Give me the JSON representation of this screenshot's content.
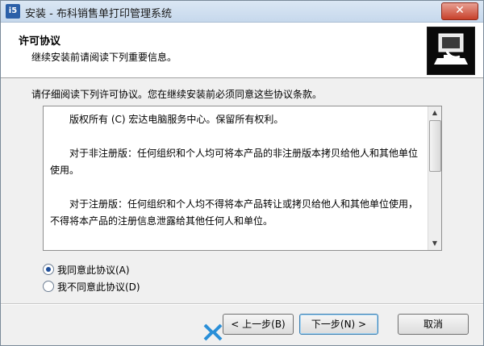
{
  "window": {
    "title": "安装 - 布科销售单打印管理系统",
    "icon_label": "i5",
    "close_label": "✕"
  },
  "header": {
    "title": "许可协议",
    "subtitle": "继续安装前请阅读下列重要信息。"
  },
  "prompt": "请仔细阅读下列许可协议。您在继续安装前必须同意这些协议条款。",
  "license": {
    "paragraphs": [
      "版权所有 (C) 宏达电脑服务中心。保留所有权利。",
      "对于非注册版：任何组织和个人均可将本产品的非注册版本拷贝给他人和其他单位使用。",
      "对于注册版：任何组织和个人均不得将本产品转让或拷贝给他人和其他单位使用，不得将本产品的注册信息泄露给其他任何人和单位。"
    ]
  },
  "radios": {
    "accept": {
      "label": "我同意此协议(A)",
      "checked": true
    },
    "decline": {
      "label": "我不同意此协议(D)",
      "checked": false
    }
  },
  "buttons": {
    "back": "< 上一步(B)",
    "next": "下一步(N) >",
    "cancel": "取消"
  },
  "icons": {
    "app": "installer-icon",
    "header": "computer-install-icon",
    "logo": "watermark-logo-icon"
  },
  "colors": {
    "accent": "#1f4f9a",
    "close": "#c7402a"
  }
}
